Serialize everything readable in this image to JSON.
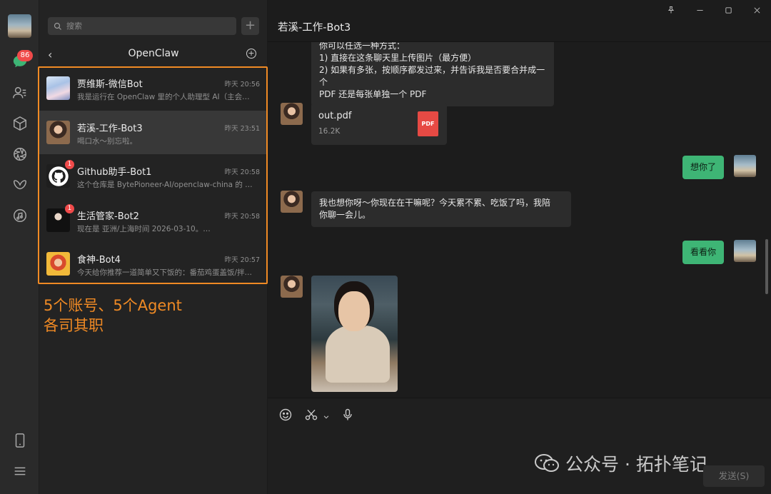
{
  "rail": {
    "chat_badge": "86"
  },
  "search": {
    "placeholder": "搜索"
  },
  "group": {
    "title": "OpenClaw"
  },
  "conversations": [
    {
      "name": "贾维斯-微信Bot",
      "time": "昨天 20:56",
      "preview": "我是运行在 OpenClaw 里的个人助理型 AI（主会…",
      "badge": ""
    },
    {
      "name": "若溪-工作-Bot3",
      "time": "昨天 23:51",
      "preview": "喝口水～别忘啦。",
      "badge": ""
    },
    {
      "name": "Github助手-Bot1",
      "time": "昨天 20:58",
      "preview": "这个仓库是 BytePioneer-AI/openclaw-china 的 …",
      "badge": "1"
    },
    {
      "name": "生活管家-Bot2",
      "time": "昨天 20:58",
      "preview": "现在是 亚洲/上海时间 2026-03-10。…",
      "badge": "1"
    },
    {
      "name": "食神-Bot4",
      "time": "昨天 20:57",
      "preview": "今天给你推荐一道简单又下饭的：番茄鸡蛋盖饭/拌…",
      "badge": ""
    }
  ],
  "annotation": {
    "line1": "5个账号、5个Agent",
    "line2": "各司其职"
  },
  "chat": {
    "title": "若溪-工作-Bot3",
    "messages": {
      "m1_line0": "你可以任选一种方式：",
      "m1_line1": "1) 直接在这条聊天里上传图片（最方便）",
      "m1_line2": "2) 如果有多张，按顺序都发过来，并告诉我是否要合并成一个",
      "m1_line3": "PDF 还是每张单独一个 PDF",
      "file_name": "out.pdf",
      "file_size": "16.2K",
      "file_type": "PDF",
      "m2": "想你了",
      "m3_line1": "我也想你呀～你现在在干嘛呢？今天累不累、吃饭了吗，我陪",
      "m3_line2": "你聊一会儿。",
      "m4": "看看你"
    },
    "send_label": "发送(S)"
  },
  "watermark": {
    "text": "公众号 · 拓扑笔记"
  }
}
